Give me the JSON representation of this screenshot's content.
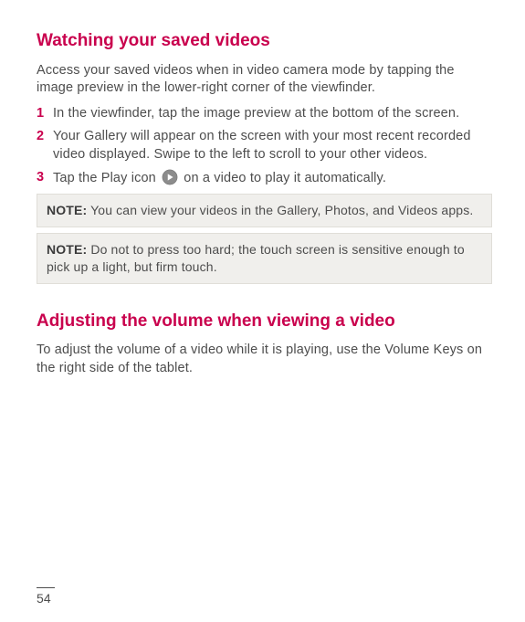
{
  "section1": {
    "heading": "Watching your saved videos",
    "intro": "Access your saved videos when in video camera mode by tapping the image preview in the lower-right corner of the viewfinder.",
    "steps": [
      {
        "num": "1",
        "text": "In the viewfinder, tap the image preview at the bottom of the screen."
      },
      {
        "num": "2",
        "text": "Your Gallery will appear on the screen with your most recent recorded video displayed. Swipe to the left to scroll to your other videos."
      },
      {
        "num": "3",
        "text_before": "Tap the Play icon",
        "text_after": "on a video to play it automatically."
      }
    ],
    "notes": [
      {
        "label": "NOTE:",
        "text": " You can view your videos in the Gallery, Photos, and Videos apps."
      },
      {
        "label": "NOTE:",
        "text": " Do not to press too hard; the touch screen is sensitive enough to pick up a light, but firm touch."
      }
    ]
  },
  "section2": {
    "heading": "Adjusting the volume when viewing a video",
    "text": "To adjust the volume of a video while it is playing, use the Volume Keys on the right side of the tablet."
  },
  "page_number": "54"
}
